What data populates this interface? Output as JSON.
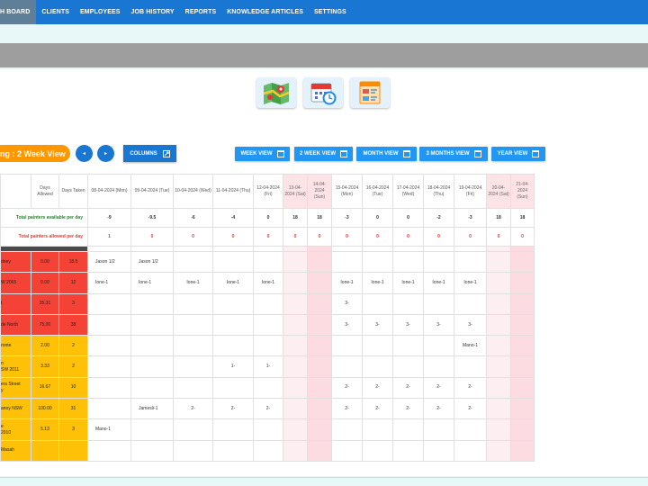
{
  "nav": {
    "items": [
      "H BOARD",
      "CLIENTS",
      "EMPLOYEES",
      "JOB HISTORY",
      "REPORTS",
      "KNOWLEDGE ARTICLES",
      "SETTINGS"
    ],
    "accent": "#1976d2"
  },
  "toolbar": {
    "view_pill": "ng : 2 Week View",
    "prev_glyph": "◂",
    "next_glyph": "▸",
    "columns_label": "COLUMNS",
    "views": [
      "WEEK VIEW",
      "2 WEEK VIEW",
      "MONTH VIEW",
      "3 MONTHS VIEW",
      "YEAR VIEW"
    ]
  },
  "icons": [
    "map-icon",
    "calendar-clock-icon",
    "planner-board-icon"
  ],
  "grid": {
    "col_allowed": "Days Allowed",
    "col_taken": "Days Taken",
    "dates": [
      "08-04-2024 (Mon)",
      "09-04-2024 (Tue)",
      "10-04-2024 (Wed)",
      "11-04-2024 (Thu)",
      "12-04-2024 (Fri)",
      "13-04-2024 (Sat)",
      "14-04-2024 (Sun)",
      "15-04-2024 (Mon)",
      "16-04-2024 (Tue)",
      "17-04-2024 (Wed)",
      "18-04-2024 (Thu)",
      "19-04-2024 (Fri)",
      "20-04-2024 (Sat)",
      "21-04-2024 (Sun)"
    ],
    "total_label": "Total painters available per day",
    "totals": [
      "-9",
      "-9.5",
      "-6",
      "-4",
      "0",
      "18",
      "18",
      "-3",
      "0",
      "0",
      "-2",
      "-3",
      "18",
      "18"
    ],
    "allowed_label": "Total painters allowed per day",
    "allowed": [
      "1",
      "0",
      "0",
      "0",
      "0",
      "0",
      "0",
      "0",
      "0",
      "0",
      "0",
      "0",
      "0",
      "0"
    ],
    "rows": [
      {
        "name": "dney",
        "allowed": "0.00",
        "taken": "18.5",
        "status": "red",
        "cells": [
          "Jason 1/2",
          "Jason 1/2",
          "",
          "",
          "",
          "",
          "",
          "",
          "",
          "",
          "",
          "",
          "",
          ""
        ]
      },
      {
        "name": "W 2065",
        "allowed": "0.00",
        "taken": "12",
        "status": "red",
        "cells": [
          "Ione-1",
          "Ione-1",
          "Ione-1",
          "Ione-1",
          "Ione-1",
          "",
          "",
          "Ione-1",
          "Ione-1",
          "Ione-1",
          "Ione-1",
          "Ione-1",
          "",
          ""
        ]
      },
      {
        "name": "t",
        "allowed": "35.31",
        "taken": "3",
        "status": "red",
        "cells": [
          "",
          "",
          "",
          "",
          "",
          "",
          "",
          "3-",
          "",
          "",
          "",
          "",
          "",
          ""
        ]
      },
      {
        "name": "de North",
        "allowed": "75.00",
        "taken": "38",
        "status": "red",
        "cells": [
          "",
          "",
          "",
          "",
          "",
          "",
          "",
          "3-",
          "3-",
          "3-",
          "3-",
          "3-",
          "",
          ""
        ]
      },
      {
        "name": "ronte",
        "allowed": "2.00",
        "taken": "2",
        "status": "amber",
        "cells": [
          "",
          "",
          "",
          "",
          "",
          "",
          "",
          "",
          "",
          "",
          "",
          "Mano-1",
          "",
          ""
        ]
      },
      {
        "name": "n\nSW 2011",
        "allowed": "3.33",
        "taken": "2",
        "status": "amber",
        "cells": [
          "",
          "",
          "",
          "1-",
          "1-",
          "",
          "",
          "",
          "",
          "",
          "",
          "",
          "",
          ""
        ]
      },
      {
        "name": "ers Street\ny",
        "allowed": "16.67",
        "taken": "10",
        "status": "amber",
        "cells": [
          "",
          "",
          "",
          "",
          "",
          "",
          "",
          "2-",
          "2-",
          "2-",
          "2-",
          "2-",
          "",
          ""
        ]
      },
      {
        "name": "anoy NSW",
        "allowed": "100.00",
        "taken": "31",
        "status": "amber",
        "cells": [
          "",
          "Jamesli-1",
          "2-",
          "2-",
          "2-",
          "",
          "",
          "2-",
          "2-",
          "2-",
          "2-",
          "2-",
          "",
          ""
        ]
      },
      {
        "name": "e\n2010",
        "allowed": "5.13",
        "taken": "3",
        "status": "amber",
        "cells": [
          "Mano-1",
          "",
          "",
          "",
          "",
          "",
          "",
          "",
          "",
          "",
          "",
          "",
          "",
          ""
        ]
      },
      {
        "name": "Masah",
        "allowed": "",
        "taken": "",
        "status": "amber",
        "cells": [
          "",
          "",
          "",
          "",
          "",
          "",
          "",
          "",
          "",
          "",
          "",
          "",
          "",
          ""
        ]
      }
    ]
  }
}
